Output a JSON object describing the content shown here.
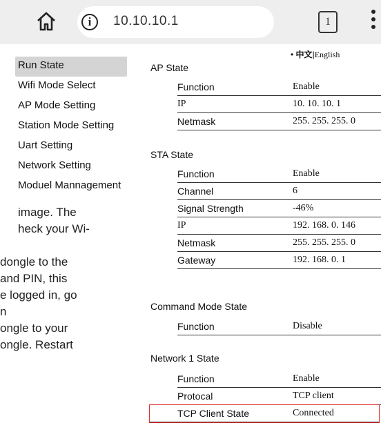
{
  "browser": {
    "url": "10.10.10.1",
    "tab_count": "1",
    "info_glyph": "i"
  },
  "language": {
    "zh": "中文",
    "separator": "|",
    "en": "English"
  },
  "sidebar": {
    "items": [
      {
        "label": "Run State",
        "active": true
      },
      {
        "label": "Wifi Mode Select"
      },
      {
        "label": "AP Mode Setting"
      },
      {
        "label": "Station Mode Setting"
      },
      {
        "label": "Uart Setting"
      },
      {
        "label": "Network Setting"
      },
      {
        "label": "Moduel Mannagement"
      }
    ]
  },
  "doc_text": [
    "image. The",
    "heck your Wi-",
    "",
    "dongle to the",
    "and PIN, this",
    "e logged in, go",
    "n",
    "ongle to your",
    "ongle. Restart"
  ],
  "ap_state": {
    "title": "AP State",
    "rows": [
      {
        "key": "Function",
        "value": "Enable"
      },
      {
        "key": "IP",
        "value": "10. 10. 10. 1"
      },
      {
        "key": "Netmask",
        "value": "255. 255. 255. 0"
      }
    ]
  },
  "sta_state": {
    "title": "STA State",
    "rows": [
      {
        "key": "Function",
        "value": "Enable"
      },
      {
        "key": "Channel",
        "value": "6"
      },
      {
        "key": "Signal Strength",
        "value": "-46%"
      },
      {
        "key": "IP",
        "value": "192. 168. 0. 146"
      },
      {
        "key": "Netmask",
        "value": "255. 255. 255. 0"
      },
      {
        "key": "Gateway",
        "value": "192. 168. 0. 1"
      }
    ]
  },
  "command_state": {
    "title": "Command Mode State",
    "rows": [
      {
        "key": "Function",
        "value": "Disable"
      }
    ]
  },
  "network1_state": {
    "title": "Network 1 State",
    "rows": [
      {
        "key": "Function",
        "value": "Enable"
      },
      {
        "key": "Protocal",
        "value": "TCP client"
      },
      {
        "key": "TCP Client State",
        "value": "Connected"
      }
    ]
  },
  "colors": {
    "highlight": "#e03030",
    "sidebar_active": "#d4d4d4",
    "topbar": "#eeeeee"
  }
}
